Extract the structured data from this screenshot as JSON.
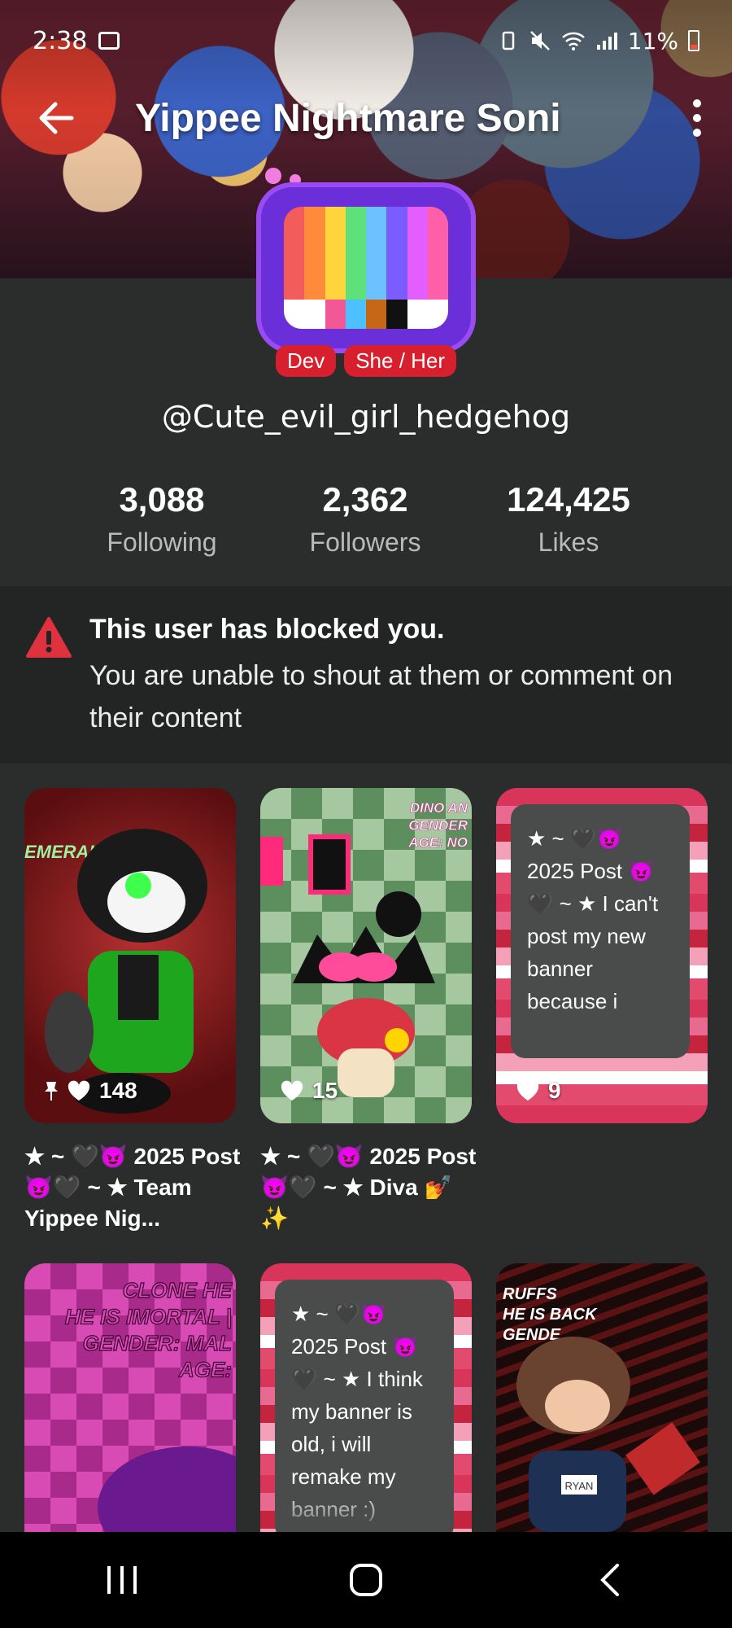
{
  "status_bar": {
    "time": "2:38",
    "battery": "11%"
  },
  "header": {
    "title": "Yippee Nightmare Soni"
  },
  "profile": {
    "badges": [
      "Dev",
      "She / Her"
    ],
    "handle": "@Cute_evil_girl_hedgehog",
    "stats": [
      {
        "value": "3,088",
        "label": "Following"
      },
      {
        "value": "2,362",
        "label": "Followers"
      },
      {
        "value": "124,425",
        "label": "Likes"
      }
    ]
  },
  "notice": {
    "title": "This user has blocked you.",
    "body": "You are unable to shout at them or comment on their content"
  },
  "posts": [
    {
      "likes": "148",
      "pinned": true,
      "title": "★ ~ 🖤😈 2025 Post 😈🖤 ~ ★ Team Yippee Nig...",
      "art_text": "EMERALD"
    },
    {
      "likes": "15",
      "pinned": false,
      "title": "★ ~ 🖤😈 2025 Post 😈🖤 ~ ★ Diva 💅✨",
      "art_text": "DINO AN / GENDER / AGE: NO"
    },
    {
      "likes": "9",
      "pinned": false,
      "title": "",
      "preview": "★ ~ 🖤😈 2025 Post 😈 🖤 ~ ★ I can't post my new banner because i"
    },
    {
      "art_text": "CLONE HE / HE IS IMORTAL | / GENDER: MAL / AGE:"
    },
    {
      "preview": "★ ~ 🖤😈 2025 Post 😈 🖤 ~ ★ I think my banner is old, i will remake my banner :)"
    },
    {
      "art_text": "RUFFS / HE IS BACK / GENDE",
      "name_tag": "RYAN"
    }
  ],
  "colors": {
    "accent": "#d71f2d",
    "background": "#2a2d2c",
    "notice_bg": "#222524"
  }
}
